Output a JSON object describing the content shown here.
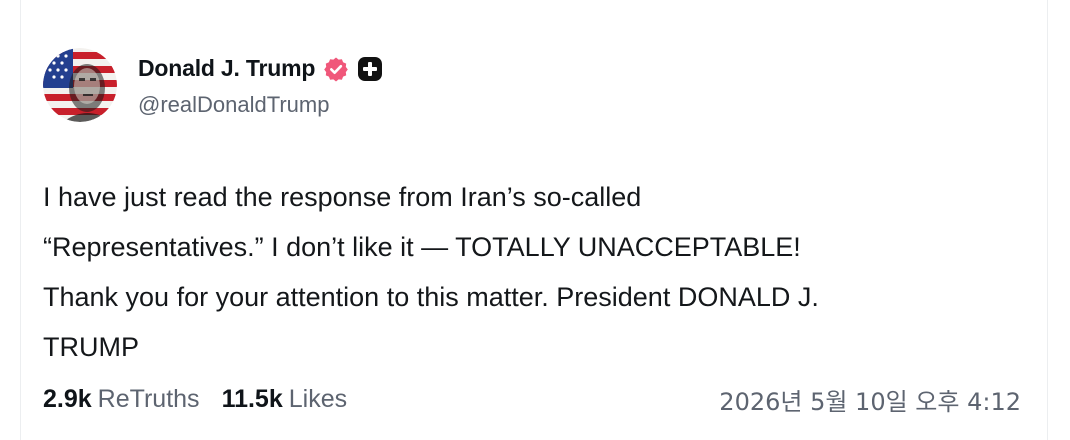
{
  "author": {
    "display_name": "Donald J. Trump",
    "handle": "@realDonaldTrump",
    "avatar_icon": "flag-portrait-avatar",
    "verified_icon": "verified-badge-icon",
    "plus_icon": "plus-badge-icon"
  },
  "post": {
    "lines": [
      "I have just read the response from Iran’s so-called",
      "“Representatives.” I don’t like it — TOTALLY UNACCEPTABLE!",
      "Thank you for your attention to this matter. President DONALD J.",
      "TRUMP"
    ]
  },
  "stats": {
    "retruths_count": "2.9k",
    "retruths_label": "ReTruths",
    "likes_count": "11.5k",
    "likes_label": "Likes"
  },
  "timestamp": "2026년 5월 10일 오후 4:12",
  "colors": {
    "verified": "#f0577a",
    "text": "#0f1419",
    "muted": "#5d6470"
  }
}
